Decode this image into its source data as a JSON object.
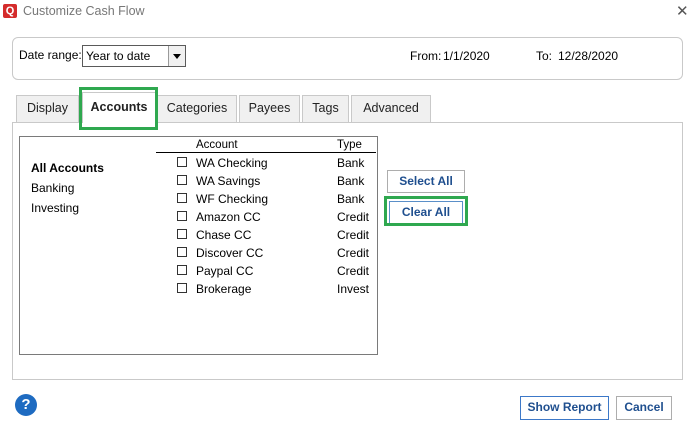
{
  "window": {
    "icon_letter": "Q",
    "title": "Customize Cash Flow",
    "close_glyph": "✕"
  },
  "date_range": {
    "label": "Date range:",
    "selected": "Year to date",
    "from_label": "From:",
    "from_value": "1/1/2020",
    "to_label": "To:",
    "to_value": "12/28/2020"
  },
  "tabs": [
    {
      "label": "Display"
    },
    {
      "label": "Accounts",
      "active": true
    },
    {
      "label": "Categories"
    },
    {
      "label": "Payees"
    },
    {
      "label": "Tags"
    },
    {
      "label": "Advanced"
    }
  ],
  "account_groups": [
    "All Accounts",
    "Banking",
    "Investing"
  ],
  "table": {
    "headers": {
      "account": "Account",
      "type": "Type"
    },
    "rows": [
      {
        "name": "WA Checking",
        "type": "Bank",
        "checked": false
      },
      {
        "name": "WA Savings",
        "type": "Bank",
        "checked": false
      },
      {
        "name": "WF Checking",
        "type": "Bank",
        "checked": false
      },
      {
        "name": "Amazon CC",
        "type": "Credit",
        "checked": false
      },
      {
        "name": "Chase CC",
        "type": "Credit",
        "checked": false
      },
      {
        "name": "Discover CC",
        "type": "Credit",
        "checked": false
      },
      {
        "name": "Paypal CC",
        "type": "Credit",
        "checked": false
      },
      {
        "name": "Brokerage",
        "type": "Invest",
        "checked": false
      }
    ]
  },
  "buttons": {
    "select_all": "Select All",
    "clear_all": "Clear All",
    "help": "?",
    "show_report": "Show Report",
    "cancel": "Cancel"
  },
  "colors": {
    "highlight": "#2fa84f",
    "brand": "#d42b2b",
    "button_text": "#1f4f8f"
  },
  "icons": {
    "app": "quicken-logo-icon",
    "close": "close-icon",
    "help": "help-icon",
    "dropdown": "chevron-down-icon"
  }
}
